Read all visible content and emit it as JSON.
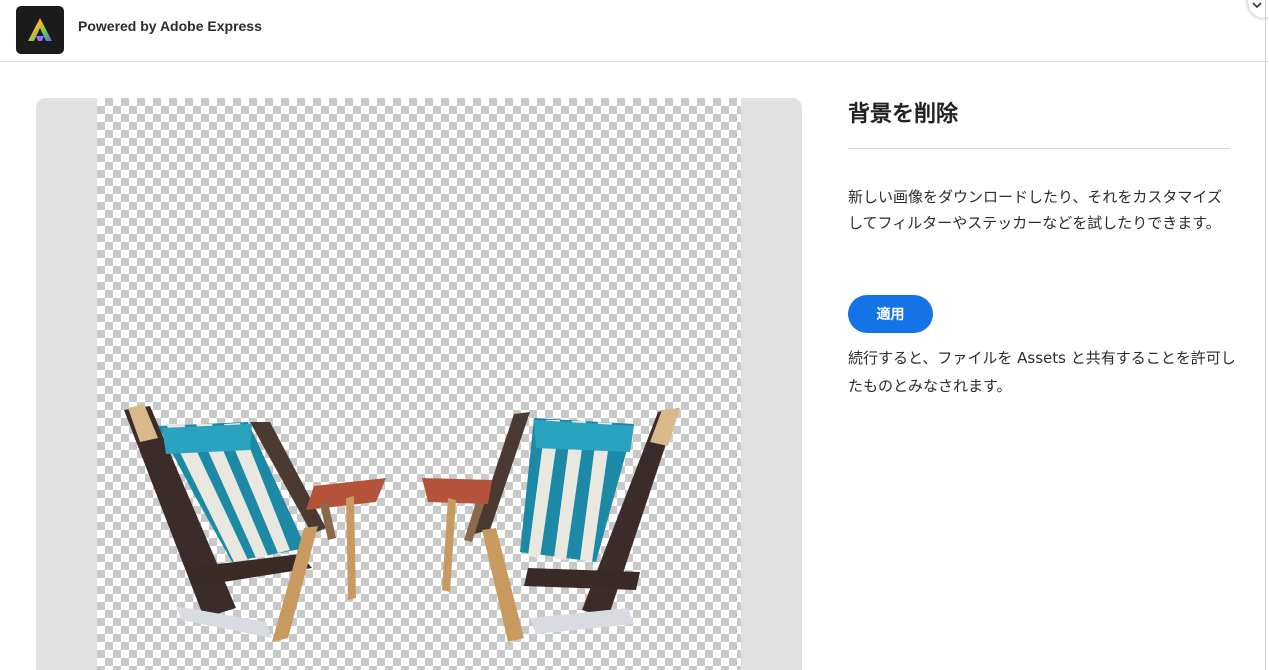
{
  "header": {
    "powered_by": "Powered by Adobe Express",
    "logo_icon": "adobe-express-logo-icon",
    "close_icon": "chevron-icon"
  },
  "preview": {
    "image_icon": "beach-chairs-image"
  },
  "panel": {
    "title": "背景を削除",
    "description": "新しい画像をダウンロードしたり、それをカスタマイズしてフィルターやステッカーなどを試したりできます。",
    "apply_label": "適用",
    "notice": "続行すると、ファイルを Assets と共有することを許可したものとみなされます。"
  },
  "colors": {
    "accent": "#1473e6",
    "preview_bg": "#e1e1e1",
    "logo_bg": "#1b1b1b"
  }
}
